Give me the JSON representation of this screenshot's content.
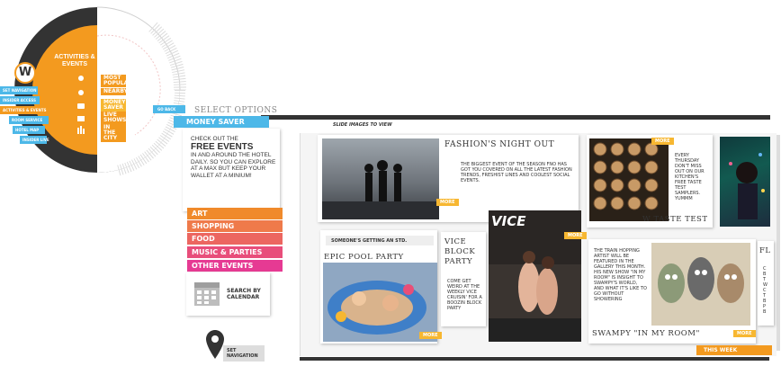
{
  "nav": {
    "logo_letter": "W",
    "wheel_title": "ACTIVITIES & EVENTS",
    "left_menu": [
      "SET NAVIGATION",
      "INSIDER ACCESS",
      "ACTIVITIES & EVENTS",
      "ROOM SERVICE",
      "HOTEL MAP",
      "INSIDER LIVE"
    ],
    "sub_menu": [
      "MOST POPULAR",
      "NEARBY",
      "MONEY SAVER",
      "LIVE SHOWS",
      "IN THE CITY"
    ],
    "go_back": "GO BACK",
    "set_navigation": "SET NAVIGATION"
  },
  "options": {
    "select_label": "SELECT OPTIONS",
    "slide_hint": "SLIDE IMAGES TO VIEW",
    "panel_title": "MONEY SAVER",
    "intro_pre": "CHECK OUT THE",
    "intro_big": "FREE EVENTS",
    "intro_post": "IN AND AROUND THE HOTEL DAILY. SO YOU CAN EXPLORE AT A MAX BUT KEEP YOUR WALLET AT A MINIUM!",
    "categories": [
      "ART",
      "SHOPPING",
      "FOOD",
      "MUSIC & PARTIES",
      "OTHER EVENTS"
    ],
    "calendar_label": "SEARCH BY CALENDAR"
  },
  "cards": {
    "fashion": {
      "title": "FASHION'S NIGHT OUT",
      "body": "THE BIGGEST EVENT OF THE SEASON FNO HAS GOT YOU COVERED ON ALL THE LATEST FASHION TRENDS, FRESHIST LINES AND COOLEST SOCIAL EVENTS.",
      "more": "MORE"
    },
    "taste": {
      "body": "EVERY THURSDAY DON'T MISS OUT ON OUR KITCHEN'S FREE TASTE TEST SAMPLERS. YUMMM",
      "title": "W TASTE TEST",
      "more": "MORE"
    },
    "pool": {
      "tag": "SOMEONE'S GETTING AN STD.",
      "title": "EPIC POOL PARTY",
      "more": "MORE"
    },
    "vice": {
      "logo": "VICE",
      "title": "VICE BLOCK PARTY",
      "body": "COME GET WEIRD AT THE WEEKLY VICE CRUISIN' FOR A BOOZIN BLOCK PARTY",
      "more": "MORE"
    },
    "swampy": {
      "body": "THE TRAIN HOPPING ARTIST WILL BE FEATURED IN THE GALLERY THIS MONTH. HIS NEW SHOW \"IN MY ROOM\" IS INSIGHT TO SWAMPY'S WORLD, AND WHAT IT'S LIKE TO GO WITHOUT SHOWERING",
      "title": "SWAMPY \"IN MY ROOM\"",
      "more": "MORE"
    },
    "partial": {
      "title": "FL",
      "body": "C B T W C T B P B"
    },
    "this_week": "THIS WEEK"
  },
  "colors": {
    "orange": "#f39a1f",
    "blue": "#4db8e8",
    "dark": "#333333",
    "cat_art": "#f08a2b",
    "cat_shopping": "#ef7a4a",
    "cat_food": "#ec6660",
    "cat_music": "#e84e7b",
    "cat_other": "#e63a93"
  }
}
